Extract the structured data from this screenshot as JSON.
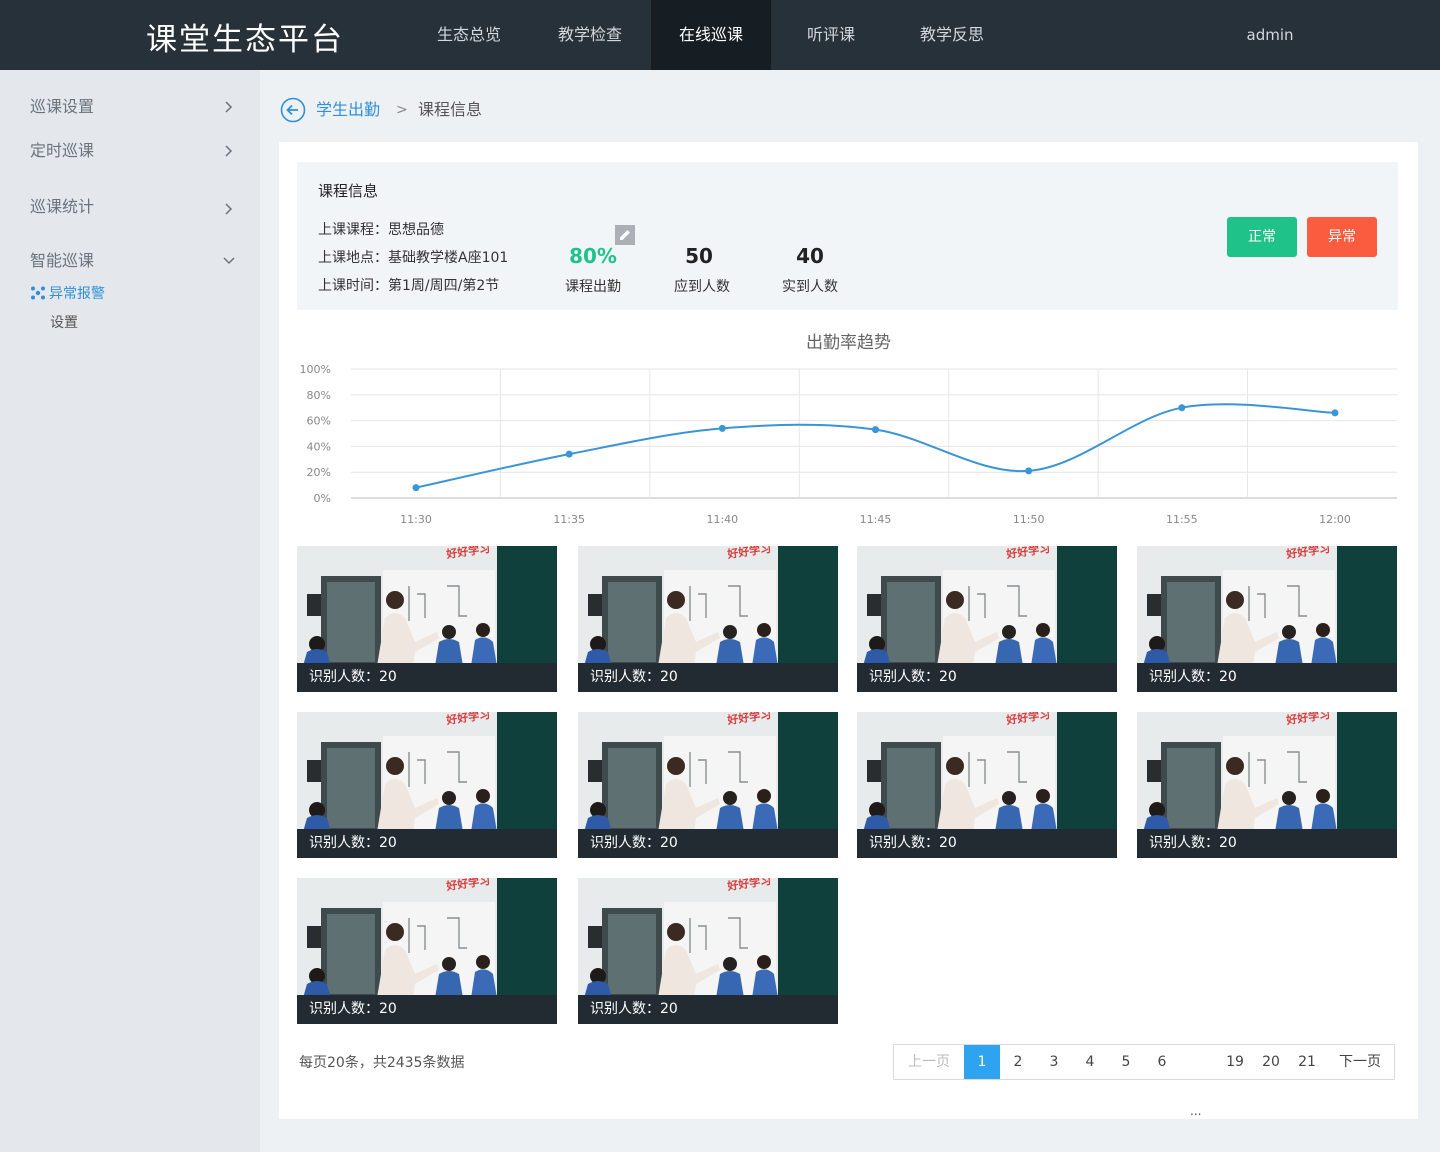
{
  "header": {
    "brand": "课堂生态平台",
    "nav": [
      "生态总览",
      "教学检查",
      "在线巡课",
      "听评课",
      "教学反思"
    ],
    "active_nav": "在线巡课",
    "user": "admin"
  },
  "sidebar": {
    "items": [
      "巡课设置",
      "定时巡课",
      "巡课统计",
      "智能巡课"
    ],
    "sub_active": "异常报警",
    "sub_plain": "设置"
  },
  "breadcrumb": {
    "parent": "学生出勤",
    "separator": ">",
    "current": "课程信息"
  },
  "course": {
    "title": "课程信息",
    "subject": "上课课程：思想品德",
    "location": "上课地点：基础教学楼A座101",
    "time": "上课时间：第1周/周四/第2节",
    "attendance_rate": "80%",
    "attendance_label": "课程出勤",
    "expected": "50",
    "expected_label": "应到人数",
    "actual": "40",
    "actual_label": "实到人数",
    "btn_normal": "正常",
    "btn_abnormal": "异常",
    "colors": {
      "rate": "#1fc38a",
      "normal": "#1fc38a",
      "abnormal": "#fb5b3f"
    }
  },
  "chart_data": {
    "type": "line",
    "title": "出勤率趋势",
    "x": [
      "11:30",
      "11:35",
      "11:40",
      "11:45",
      "11:50",
      "11:55",
      "12:00"
    ],
    "series": [
      {
        "values": [
          8,
          34,
          54,
          53,
          21,
          70,
          66
        ]
      }
    ],
    "yticks": [
      "100%",
      "80%",
      "60%",
      "40%",
      "20%",
      "0%"
    ],
    "ylim": [
      0,
      100
    ],
    "grid": true,
    "color": "#3a95d6"
  },
  "photos": {
    "caption": "识别人数：20",
    "banner_text": "好好学习",
    "count": 10
  },
  "pagination": {
    "summary": "每页20条，共2435条数据",
    "prev": "上一页",
    "next": "下一页",
    "pages": [
      "1",
      "2",
      "3",
      "4",
      "5",
      "6",
      "19",
      "20",
      "21"
    ],
    "current": "1",
    "ellipsis": "..."
  }
}
